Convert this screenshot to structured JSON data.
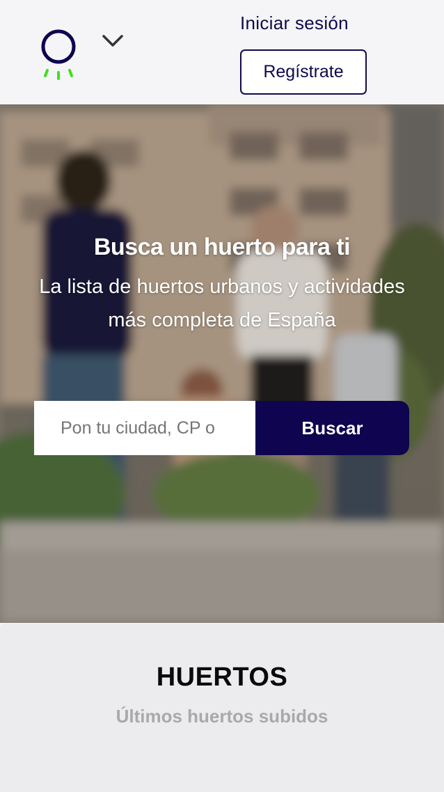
{
  "header": {
    "login_label": "Iniciar sesión",
    "register_label": "Regístrate",
    "logo_icon": "lightbulb-logo-icon",
    "menu_icon": "chevron-down-icon",
    "colors": {
      "brand_navy": "#0e0450",
      "accent_green": "#3fe01c"
    }
  },
  "hero": {
    "title": "Busca un huerto para ti",
    "subtitle_line1": "La lista de huertos urbanos y actividades",
    "subtitle_line2": "más completa de España",
    "search": {
      "placeholder": "Pon tu ciudad, CP o",
      "value": "",
      "button_label": "Buscar"
    }
  },
  "section": {
    "title": "HUERTOS",
    "subtitle": "Últimos huertos subidos"
  }
}
